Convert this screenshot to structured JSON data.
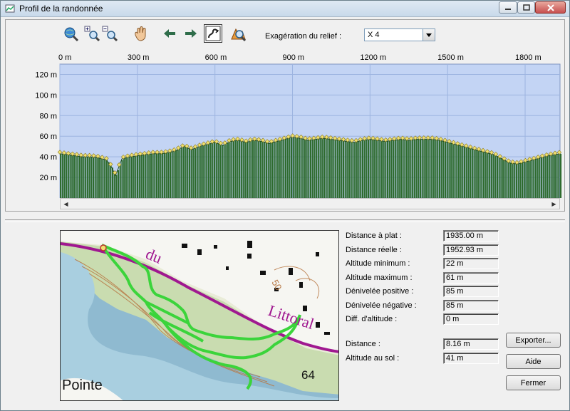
{
  "window": {
    "title": "Profil de la randonnée"
  },
  "toolbar": {
    "tools": [
      {
        "name": "zoom-globe-icon"
      },
      {
        "name": "zoom-in-icon"
      },
      {
        "name": "zoom-out-icon"
      },
      {
        "name": "pan-hand-icon"
      },
      {
        "name": "arrow-left-icon"
      },
      {
        "name": "arrow-right-icon"
      },
      {
        "name": "route-view-icon"
      },
      {
        "name": "profile-search-icon"
      }
    ],
    "relief_label": "Exagération du relief :",
    "relief_value": "X 4"
  },
  "chart_data": {
    "type": "area",
    "x_ticks": [
      "0 m",
      "300 m",
      "600 m",
      "900 m",
      "1200 m",
      "1500 m",
      "1800 m"
    ],
    "y_ticks": [
      "20 m",
      "40 m",
      "60 m",
      "80 m",
      "100 m",
      "120 m"
    ],
    "xlim": [
      0,
      1935
    ],
    "ylim": [
      0,
      130
    ],
    "grid": true,
    "colors": {
      "sky": "#c3d4f4",
      "ground": "#2e6b2e",
      "points": "#f0e070",
      "grid": "#9db4e0"
    },
    "profile": [
      [
        0,
        43
      ],
      [
        30,
        42
      ],
      [
        60,
        41
      ],
      [
        90,
        40
      ],
      [
        120,
        40
      ],
      [
        150,
        39
      ],
      [
        180,
        37
      ],
      [
        200,
        30
      ],
      [
        215,
        22
      ],
      [
        225,
        28
      ],
      [
        240,
        38
      ],
      [
        270,
        40
      ],
      [
        300,
        41
      ],
      [
        330,
        42
      ],
      [
        360,
        43
      ],
      [
        390,
        43
      ],
      [
        420,
        44
      ],
      [
        450,
        46
      ],
      [
        480,
        50
      ],
      [
        510,
        47
      ],
      [
        540,
        50
      ],
      [
        570,
        52
      ],
      [
        600,
        54
      ],
      [
        630,
        51
      ],
      [
        660,
        55
      ],
      [
        690,
        56
      ],
      [
        720,
        54
      ],
      [
        750,
        56
      ],
      [
        780,
        55
      ],
      [
        810,
        53
      ],
      [
        840,
        55
      ],
      [
        870,
        57
      ],
      [
        900,
        59
      ],
      [
        930,
        58
      ],
      [
        960,
        56
      ],
      [
        990,
        57
      ],
      [
        1020,
        58
      ],
      [
        1050,
        57
      ],
      [
        1080,
        56
      ],
      [
        1110,
        55
      ],
      [
        1140,
        54
      ],
      [
        1170,
        56
      ],
      [
        1200,
        57
      ],
      [
        1230,
        56
      ],
      [
        1260,
        55
      ],
      [
        1290,
        56
      ],
      [
        1320,
        57
      ],
      [
        1350,
        56
      ],
      [
        1380,
        57
      ],
      [
        1410,
        57
      ],
      [
        1440,
        57
      ],
      [
        1470,
        56
      ],
      [
        1500,
        54
      ],
      [
        1530,
        52
      ],
      [
        1560,
        50
      ],
      [
        1590,
        48
      ],
      [
        1620,
        46
      ],
      [
        1650,
        44
      ],
      [
        1680,
        42
      ],
      [
        1710,
        38
      ],
      [
        1740,
        34
      ],
      [
        1770,
        33
      ],
      [
        1800,
        35
      ],
      [
        1830,
        37
      ],
      [
        1860,
        39
      ],
      [
        1890,
        41
      ],
      [
        1935,
        43
      ]
    ]
  },
  "map": {
    "labels": {
      "road": "du",
      "road2": "Littoral",
      "place": "Pointe",
      "spot": "64",
      "contour": "50"
    }
  },
  "stats": [
    {
      "label": "Distance à plat :",
      "value": "1935.00 m"
    },
    {
      "label": "Distance réelle :",
      "value": "1952.93 m"
    },
    {
      "label": "Altitude minimum :",
      "value": "22 m"
    },
    {
      "label": "Altitude maximum :",
      "value": "61 m"
    },
    {
      "label": "Dénivelée positive :",
      "value": "85 m"
    },
    {
      "label": "Dénivelée négative :",
      "value": "85 m"
    },
    {
      "label": "Diff. d'altitude :",
      "value": "0 m"
    }
  ],
  "cursor": [
    {
      "label": "Distance :",
      "value": "8.16 m"
    },
    {
      "label": "Altitude au sol :",
      "value": "41 m"
    }
  ],
  "buttons": {
    "export": "Exporter...",
    "help": "Aide",
    "close": "Fermer"
  }
}
